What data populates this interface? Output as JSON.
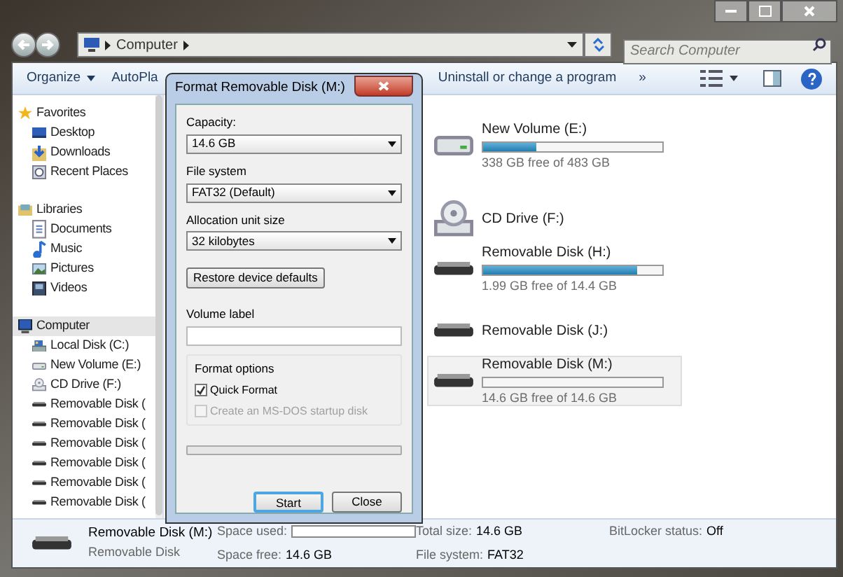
{
  "address": {
    "breadcrumb": [
      "Computer"
    ]
  },
  "search": {
    "placeholder": "Search Computer"
  },
  "toolbar": {
    "items": [
      {
        "label": "Organize",
        "has_menu": true
      },
      {
        "label": "AutoPla",
        "has_menu": false
      },
      {
        "label": "Uninstall or change a program",
        "has_menu": false
      },
      {
        "label": "»",
        "has_menu": false
      }
    ]
  },
  "nav": {
    "groups": [
      {
        "label": "Favorites",
        "kind": "star",
        "selected": false,
        "children": [
          {
            "label": "Desktop",
            "kind": "desktop",
            "selected": false
          },
          {
            "label": "Downloads",
            "kind": "downloads",
            "selected": false
          },
          {
            "label": "Recent Places",
            "kind": "recent",
            "selected": false
          }
        ]
      },
      {
        "label": "Libraries",
        "kind": "library",
        "selected": false,
        "children": [
          {
            "label": "Documents",
            "kind": "document",
            "selected": false
          },
          {
            "label": "Music",
            "kind": "music",
            "selected": false
          },
          {
            "label": "Pictures",
            "kind": "picture",
            "selected": false
          },
          {
            "label": "Videos",
            "kind": "video",
            "selected": false
          }
        ]
      },
      {
        "label": "Computer",
        "kind": "computer",
        "selected": true,
        "children": [
          {
            "label": "Local Disk (C:)",
            "kind": "system-disk",
            "selected": false
          },
          {
            "label": "New Volume (E:)",
            "kind": "disk",
            "selected": false
          },
          {
            "label": "CD Drive (F:)",
            "kind": "cd",
            "selected": false
          },
          {
            "label": "Removable Disk (",
            "kind": "usb",
            "selected": false
          },
          {
            "label": "Removable Disk (",
            "kind": "usb",
            "selected": false
          },
          {
            "label": "Removable Disk (",
            "kind": "usb",
            "selected": false
          },
          {
            "label": "Removable Disk (",
            "kind": "usb",
            "selected": false
          },
          {
            "label": "Removable Disk (",
            "kind": "usb",
            "selected": false
          },
          {
            "label": "Removable Disk (",
            "kind": "usb",
            "selected": false
          }
        ]
      }
    ]
  },
  "drives": [
    {
      "name": "New Volume (E:)",
      "kind": "disk",
      "level": 0.3,
      "free": "338 GB free of 483 GB",
      "selected": false
    },
    {
      "name": "CD Drive (F:)",
      "kind": "cd",
      "selected": false
    },
    {
      "name": "Removable Disk (H:)",
      "kind": "usb",
      "level": 0.86,
      "free": "1.99 GB free of 14.4 GB",
      "selected": false
    },
    {
      "name": "Removable Disk (J:)",
      "kind": "usb",
      "selected": false
    },
    {
      "name": "Removable Disk (M:)",
      "kind": "usb",
      "level": 0,
      "free": "14.6 GB free of 14.6 GB",
      "selected": true
    }
  ],
  "details": {
    "name": "Removable Disk (M:)",
    "type": "Removable Disk",
    "fields": [
      {
        "label": "Space used:",
        "level": 0
      },
      {
        "label": "Space free:",
        "value": "14.6 GB"
      },
      {
        "label": "Total size:",
        "value": "14.6 GB"
      },
      {
        "label": "File system:",
        "value": "FAT32"
      },
      {
        "label": "BitLocker status:",
        "value": "Off"
      }
    ]
  },
  "dialog": {
    "title": "Format Removable Disk (M:)",
    "selects": [
      {
        "label": "Capacity:",
        "value": "14.6 GB"
      },
      {
        "label": "File system",
        "value": "FAT32 (Default)"
      },
      {
        "label": "Allocation unit size",
        "value": "32 kilobytes"
      }
    ],
    "restore_button": "Restore device defaults",
    "volume_label": {
      "label": "Volume label"
    },
    "format_options": {
      "title": "Format options",
      "options": [
        {
          "label": "Quick Format",
          "checked": true,
          "disabled": false
        },
        {
          "label": "Create an MS-DOS startup disk",
          "checked": false,
          "disabled": true
        }
      ]
    },
    "progress": {
      "level": 0
    },
    "buttons": [
      {
        "label": "Start",
        "default": true
      },
      {
        "label": "Close",
        "default": false
      }
    ]
  }
}
